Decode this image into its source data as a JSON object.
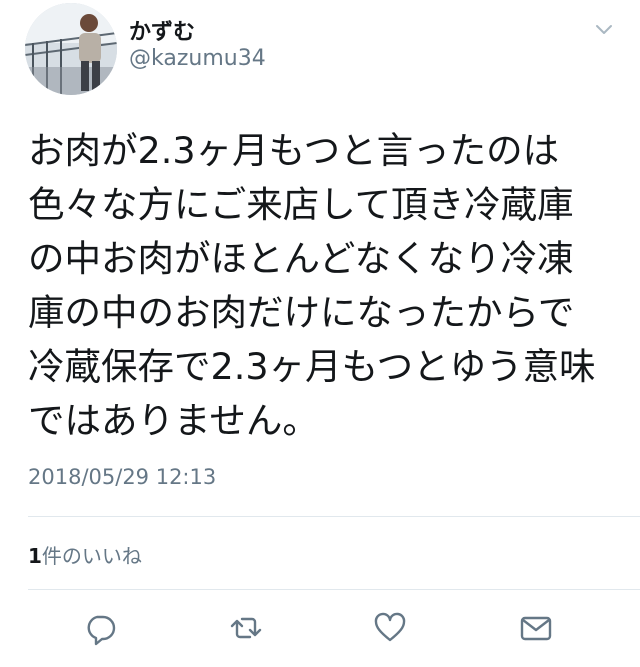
{
  "user": {
    "display_name": "かずむ",
    "handle": "@kazumu34",
    "avatar_icon": "user-photo",
    "menu_icon": "chevron-down-icon"
  },
  "tweet": {
    "lines": [
      "お肉が2.3ヶ月もつと言ったのは",
      "色々な方にご来店して頂き冷蔵庫",
      "の中お肉がほとんどなくなり冷凍",
      "庫の中のお肉だけになったからで",
      "冷蔵保存で2.3ヶ月もつとゆう意味",
      "ではありません。"
    ],
    "timestamp": "2018/05/29 12:13"
  },
  "stats": {
    "likes_count": "1",
    "likes_label": "件のいいね"
  },
  "actions": [
    {
      "name": "reply",
      "icon": "reply-icon"
    },
    {
      "name": "retweet",
      "icon": "retweet-icon"
    },
    {
      "name": "like",
      "icon": "heart-icon"
    },
    {
      "name": "share",
      "icon": "mail-icon"
    }
  ],
  "colors": {
    "text": "#14171a",
    "secondary": "#657786",
    "divider": "#e1e8ed"
  }
}
